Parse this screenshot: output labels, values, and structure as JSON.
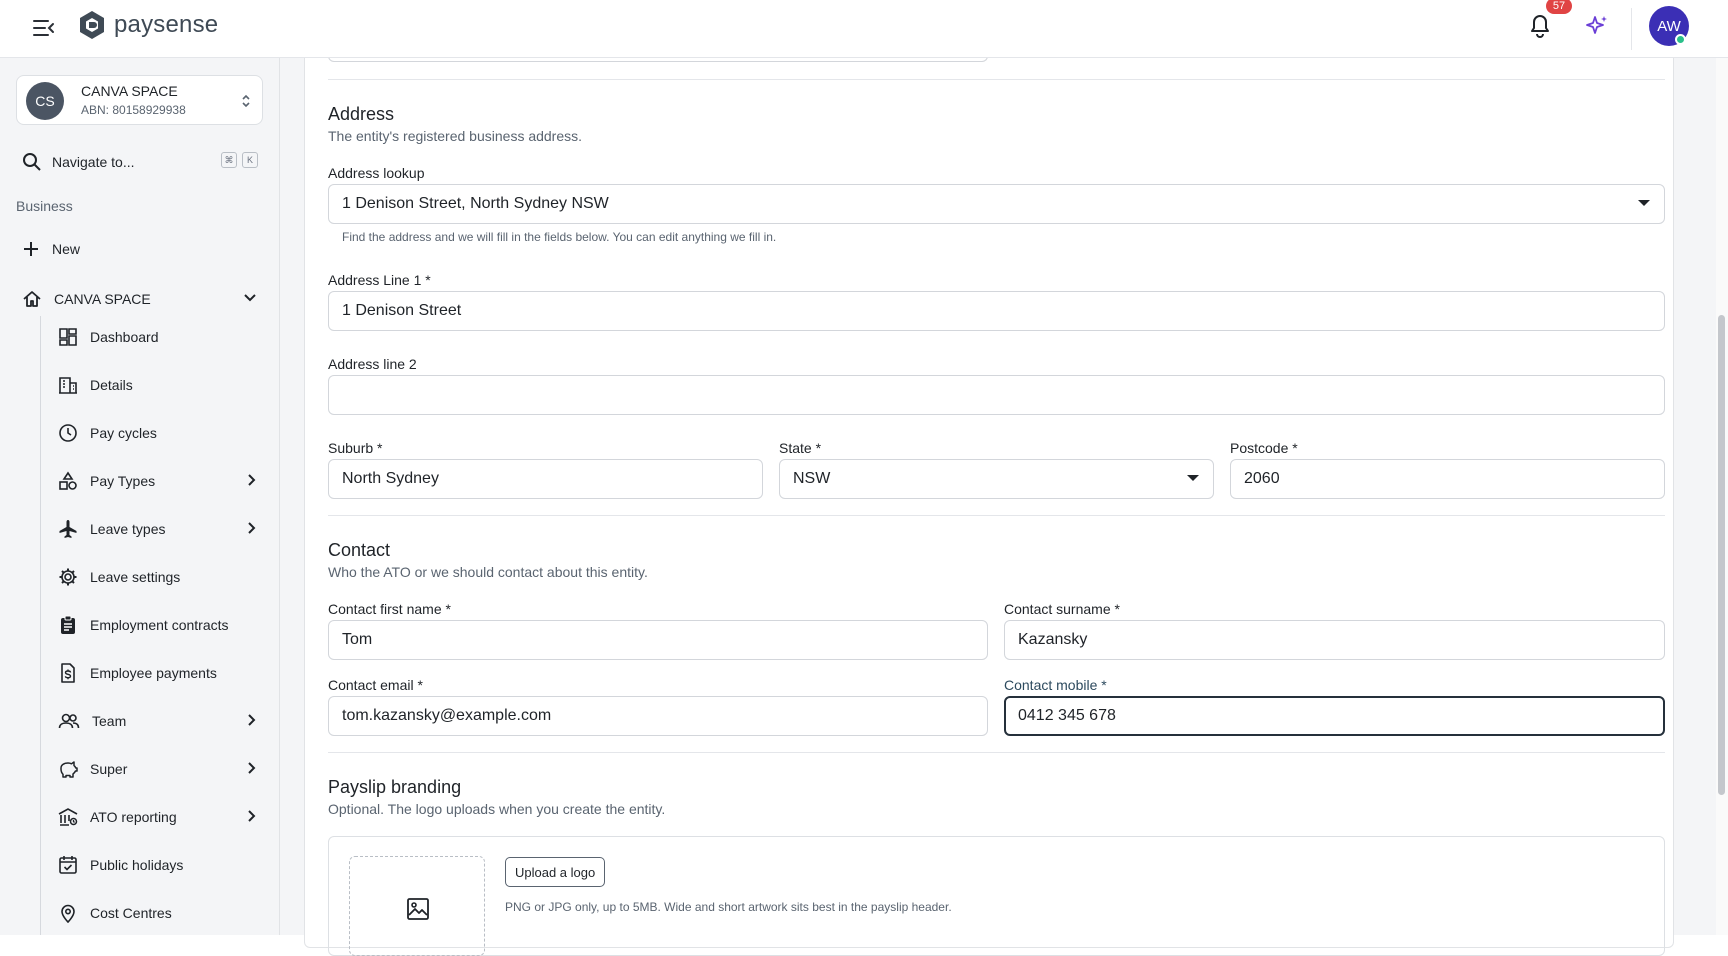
{
  "topbar": {
    "brand_name": "paysense",
    "notification_count": "57",
    "user_initials": "AW"
  },
  "sidebar": {
    "org": {
      "initials": "CS",
      "name": "CANVA SPACE",
      "abn": "ABN: 80158929938"
    },
    "search_label": "Navigate to...",
    "kbd_cmd": "⌘",
    "kbd_k": "K",
    "section_label": "Business",
    "new_label": "New",
    "org_nav_label": "CANVA SPACE",
    "items": [
      {
        "label": "Dashboard",
        "icon": "dashboard-icon"
      },
      {
        "label": "Details",
        "icon": "building-icon"
      },
      {
        "label": "Pay cycles",
        "icon": "clock-icon"
      },
      {
        "label": "Pay Types",
        "icon": "shapes-icon",
        "expandable": true
      },
      {
        "label": "Leave types",
        "icon": "plane-icon",
        "expandable": true
      },
      {
        "label": "Leave settings",
        "icon": "gear-icon"
      },
      {
        "label": "Employment contracts",
        "icon": "clipboard-icon"
      },
      {
        "label": "Employee payments",
        "icon": "dollar-file-icon"
      },
      {
        "label": "Team",
        "icon": "people-icon",
        "expandable": true
      },
      {
        "label": "Super",
        "icon": "piggy-bank-icon",
        "expandable": true
      },
      {
        "label": "ATO reporting",
        "icon": "bank-icon",
        "expandable": true
      },
      {
        "label": "Public holidays",
        "icon": "calendar-icon"
      },
      {
        "label": "Cost Centres",
        "icon": "location-pin-icon"
      }
    ]
  },
  "address": {
    "title": "Address",
    "subtitle": "The entity's registered business address.",
    "lookup_label": "Address lookup",
    "lookup_value": "1 Denison Street, North Sydney NSW",
    "lookup_helper": "Find the address and we will fill in the fields below. You can edit anything we fill in.",
    "line1_label": "Address Line 1 *",
    "line1_value": "1 Denison Street",
    "line2_label": "Address line 2",
    "line2_value": "",
    "suburb_label": "Suburb *",
    "suburb_value": "North Sydney",
    "state_label": "State *",
    "state_value": "NSW",
    "postcode_label": "Postcode *",
    "postcode_value": "2060"
  },
  "contact": {
    "title": "Contact",
    "subtitle": "Who the ATO or we should contact about this entity.",
    "first_name_label": "Contact first name *",
    "first_name_value": "Tom",
    "surname_label": "Contact surname *",
    "surname_value": "Kazansky",
    "email_label": "Contact email *",
    "email_value": "tom.kazansky@example.com",
    "mobile_label": "Contact mobile *",
    "mobile_value": "0412 345 678"
  },
  "branding": {
    "title": "Payslip branding",
    "subtitle": "Optional. The logo uploads when you create the entity.",
    "upload_label": "Upload a logo",
    "upload_helper": "PNG or JPG only, up to 5MB. Wide and short artwork sits best in the payslip header."
  }
}
